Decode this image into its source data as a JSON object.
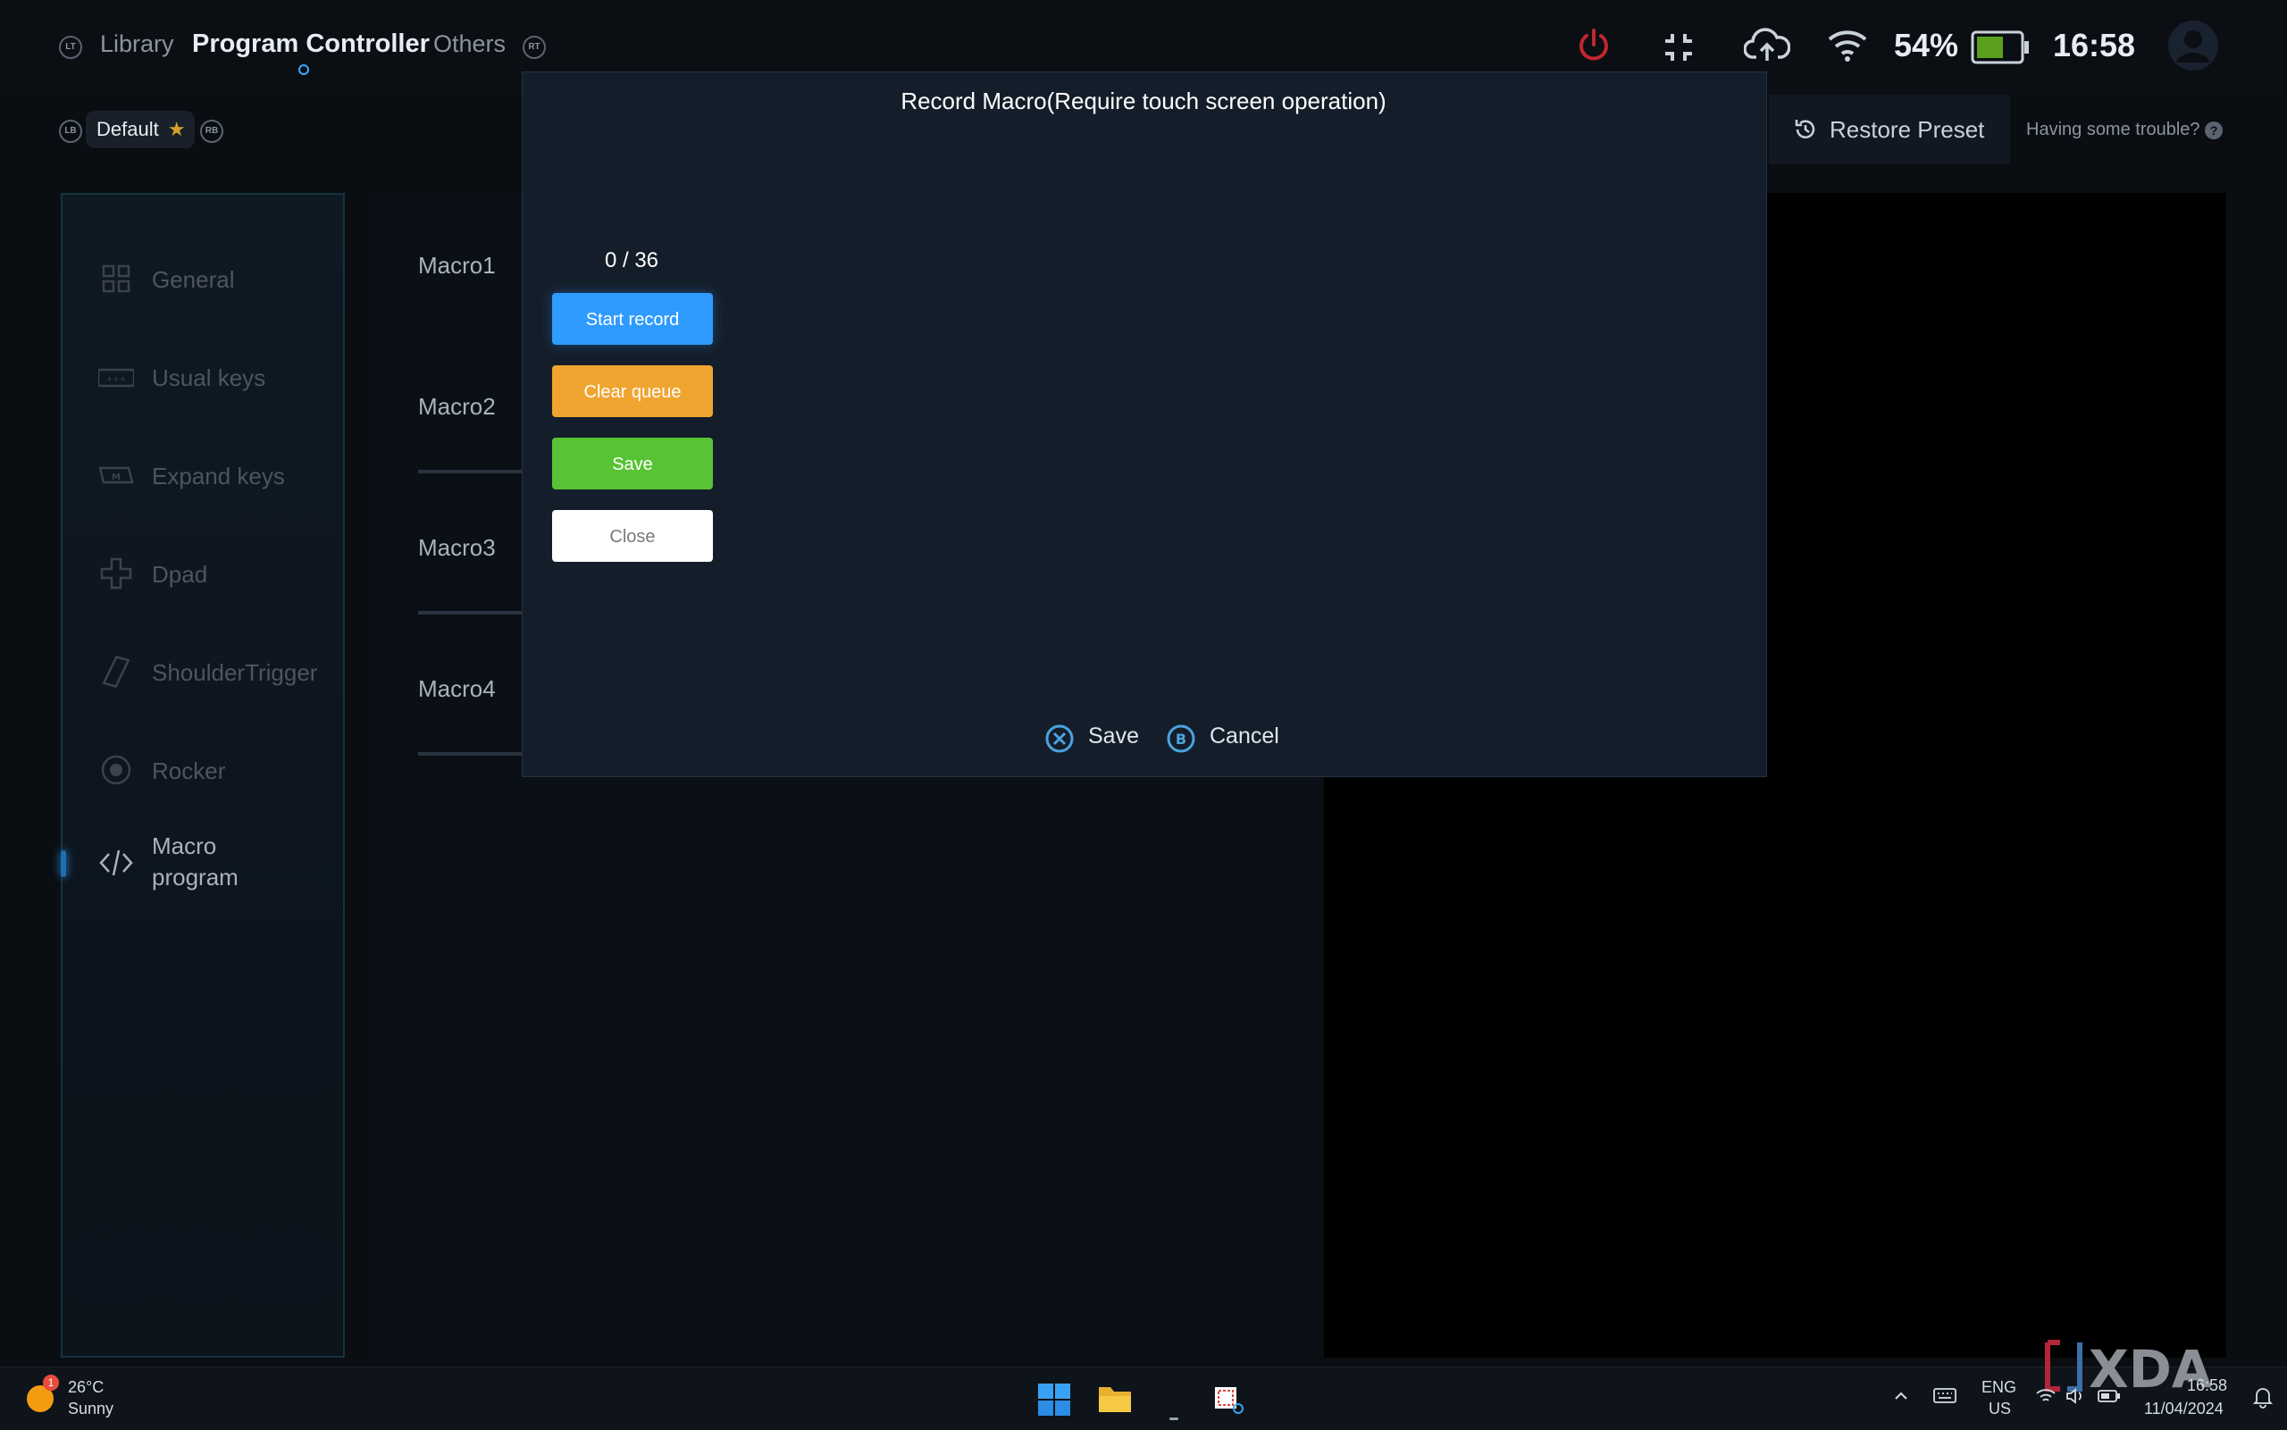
{
  "topbar": {
    "lt_label": "LT",
    "rt_label": "RT",
    "tabs": [
      {
        "label": "Library"
      },
      {
        "label": "Program Controller"
      },
      {
        "label": "Others"
      }
    ],
    "battery_percent": "54%",
    "time": "16:58"
  },
  "subbar": {
    "lb_label": "LB",
    "rb_label": "RB",
    "preset": "Default",
    "restore_label": "Restore Preset",
    "trouble_label": "Having some trouble?"
  },
  "sidebar": {
    "items": [
      {
        "label": "General"
      },
      {
        "label": "Usual keys"
      },
      {
        "label": "Expand keys"
      },
      {
        "label": "Dpad"
      },
      {
        "label": "ShoulderTrigger"
      },
      {
        "label": "Rocker"
      },
      {
        "label": "Macro program"
      }
    ]
  },
  "macros": [
    {
      "label": "Macro1"
    },
    {
      "label": "Macro2"
    },
    {
      "label": "Macro3"
    },
    {
      "label": "Macro4"
    }
  ],
  "dialog": {
    "title": "Record Macro(Require touch screen operation)",
    "counter": "0 / 36",
    "start_record": "Start record",
    "clear_queue": "Clear queue",
    "save": "Save",
    "close": "Close",
    "footer_save": "Save",
    "footer_cancel": "Cancel",
    "footer_save_icon": "x-button-icon",
    "footer_cancel_icon": "b-button-icon"
  },
  "taskbar": {
    "weather_temp": "26°C",
    "weather_desc": "Sunny",
    "weather_badge": "1",
    "lang_top": "ENG",
    "lang_bottom": "US",
    "clock_time": "16:58",
    "clock_date": "11/04/2024"
  },
  "colors": {
    "accent_blue": "#2f9bff",
    "accent_orange": "#f0a531",
    "accent_green": "#58c335",
    "power_red": "#c0262d",
    "battery_green": "#5aa01e"
  }
}
